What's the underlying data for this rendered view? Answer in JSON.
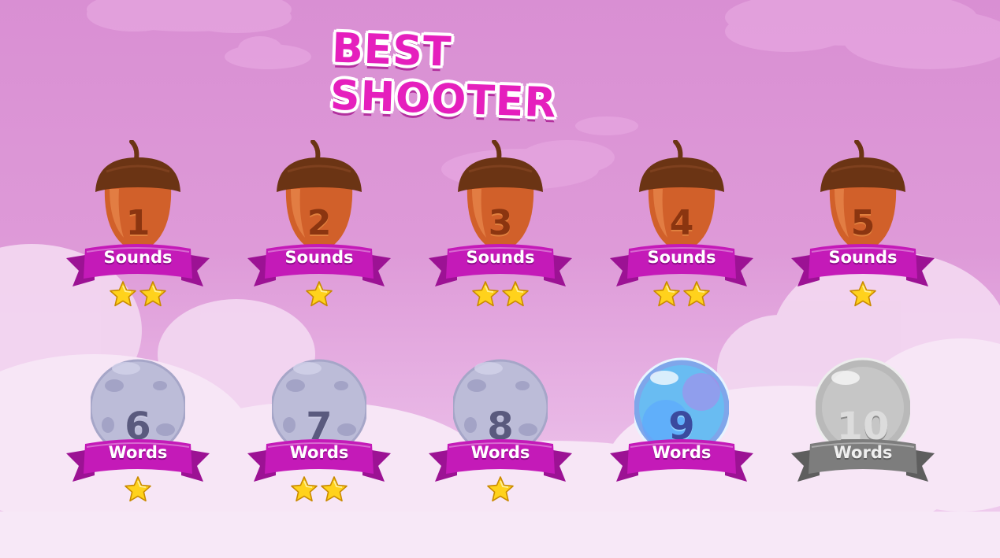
{
  "title": "BEST SHOOTER",
  "levels": [
    {
      "number": "1",
      "label": "Sounds",
      "stars": 2,
      "style": "acorn"
    },
    {
      "number": "2",
      "label": "Sounds",
      "stars": 1,
      "style": "acorn"
    },
    {
      "number": "3",
      "label": "Sounds",
      "stars": 2,
      "style": "acorn"
    },
    {
      "number": "4",
      "label": "Sounds",
      "stars": 2,
      "style": "acorn"
    },
    {
      "number": "5",
      "label": "Sounds",
      "stars": 1,
      "style": "acorn"
    },
    {
      "number": "6",
      "label": "Words",
      "stars": 1,
      "style": "orb"
    },
    {
      "number": "7",
      "label": "Words",
      "stars": 2,
      "style": "orb"
    },
    {
      "number": "8",
      "label": "Words",
      "stars": 1,
      "style": "orb"
    },
    {
      "number": "9",
      "label": "Words",
      "stars": 0,
      "style": "bubble"
    },
    {
      "number": "10",
      "label": "Words",
      "stars": 0,
      "style": "locked"
    }
  ],
  "colors": {
    "title": "#e51fbd",
    "ribbon": "#c41ab8",
    "ribbon_locked": "#7d7d7d",
    "acorn_cap": "#6b3414",
    "acorn_body": "#d1602a",
    "star": "#ffd21c"
  }
}
